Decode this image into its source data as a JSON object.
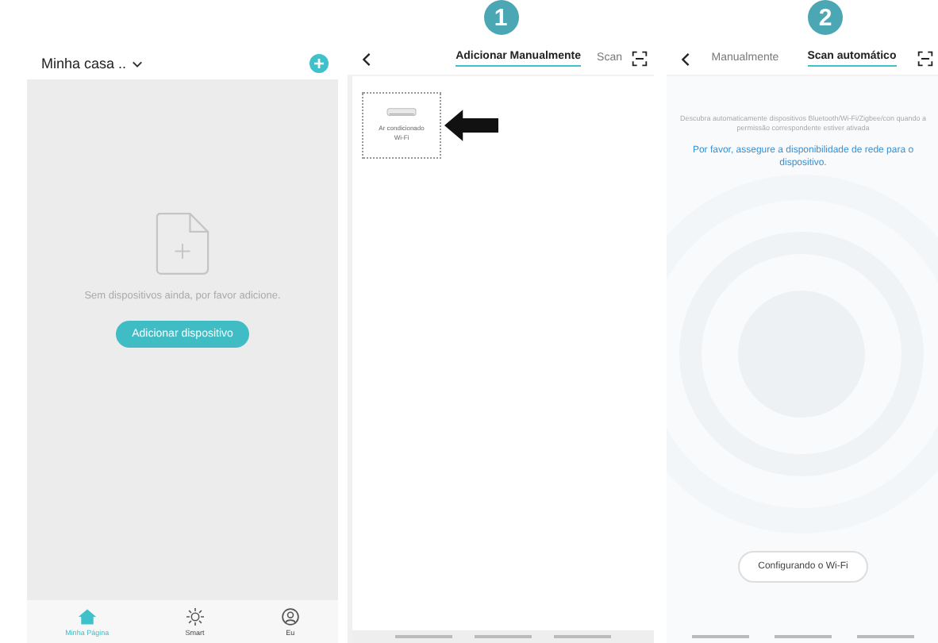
{
  "home": {
    "home_selector": "Minha casa ..",
    "empty_message": "Sem dispositivos ainda, por favor adicione.",
    "add_button": "Adicionar dispositivo",
    "nav": [
      {
        "kind": "home",
        "label": "Minha Página",
        "selected": true
      },
      {
        "kind": "smart",
        "label": "Smart",
        "selected": false
      },
      {
        "kind": "me",
        "label": "Eu",
        "selected": false
      }
    ]
  },
  "manual": {
    "badge": "1",
    "tabs": [
      {
        "label": "Adicionar Manualmente",
        "selected": true
      },
      {
        "label": "Scan",
        "selected": false
      }
    ],
    "devices": [
      {
        "name": "Ar condicionado Wi-Fi"
      }
    ]
  },
  "scan": {
    "badge": "2",
    "tabs": [
      {
        "label": "Manualmente",
        "selected": false
      },
      {
        "label": "Scan automático",
        "selected": true
      }
    ],
    "hint": "Descubra automaticamente dispositivos Bluetooth/Wi-Fi/Zigbee/con quando a permissão correspondente estiver ativada",
    "notice": "Por favor, assegure a disponibilidade de rede para o dispositivo.",
    "action": "Configurando o Wi-Fi"
  }
}
